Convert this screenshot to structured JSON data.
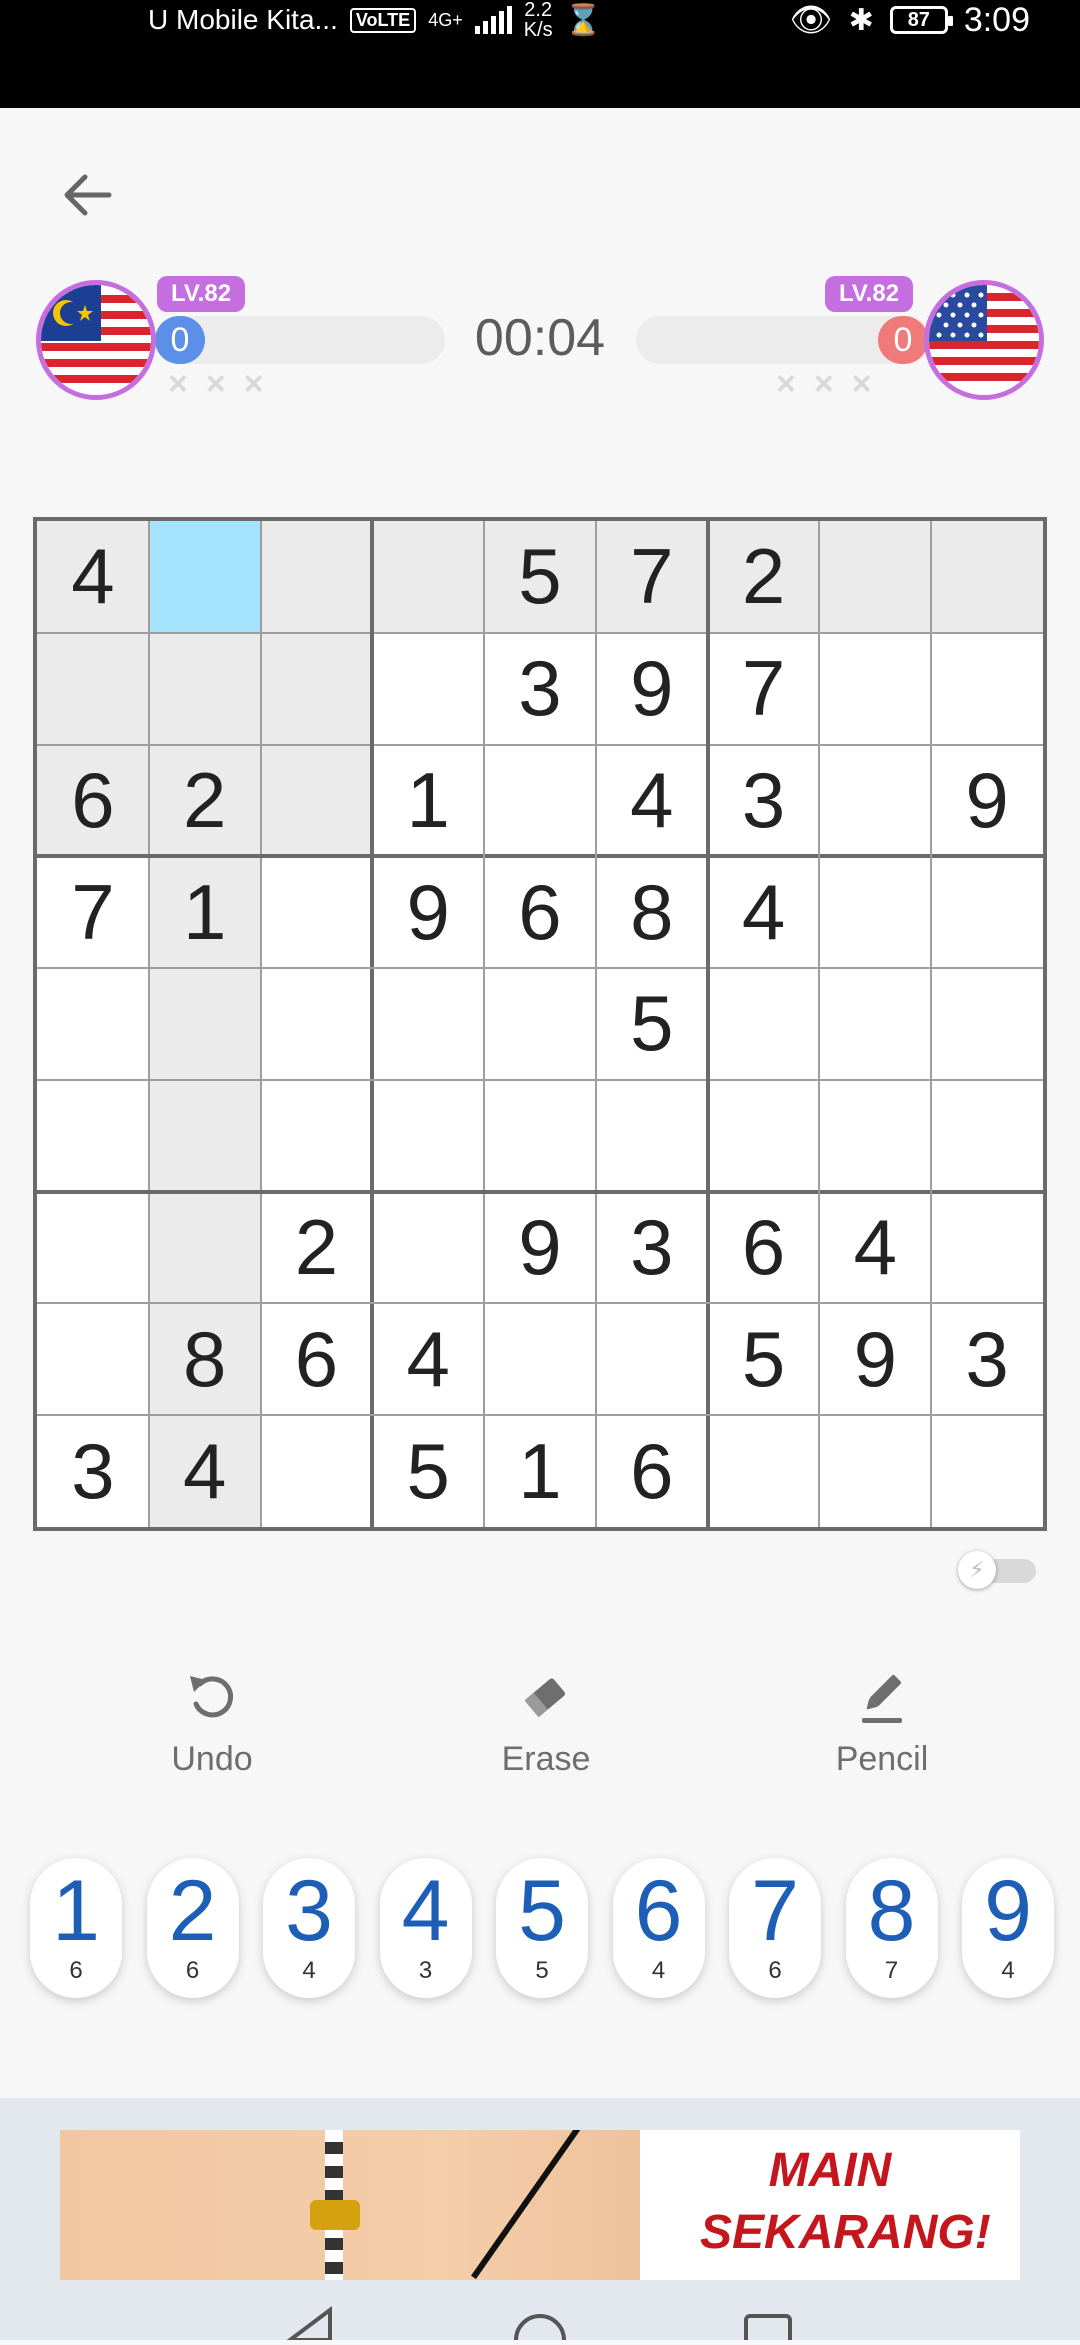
{
  "status_bar": {
    "carrier": "U Mobile Kita...",
    "volte": "VoLTE",
    "network": "4G+",
    "speed_value": "2.2",
    "speed_unit": "K/s",
    "battery": "87",
    "time": "3:09"
  },
  "players": {
    "left": {
      "level": "LV.82",
      "score": "0",
      "flag": "malaysia-flag-icon",
      "progress": 0
    },
    "right": {
      "level": "LV.82",
      "score": "0",
      "flag": "usa-flag-icon",
      "progress": 0
    }
  },
  "timer": "00:04",
  "mistake_marks": "×××",
  "board": {
    "cells": [
      [
        "4",
        "",
        "",
        "",
        "5",
        "7",
        "2",
        "",
        ""
      ],
      [
        "",
        "",
        "",
        "",
        "3",
        "9",
        "7",
        "",
        ""
      ],
      [
        "6",
        "2",
        "",
        "1",
        "",
        "4",
        "3",
        "",
        "9"
      ],
      [
        "7",
        "1",
        "",
        "9",
        "6",
        "8",
        "4",
        "",
        ""
      ],
      [
        "",
        "",
        "",
        "",
        "",
        "5",
        "",
        "",
        ""
      ],
      [
        "",
        "",
        "",
        "",
        "",
        "",
        "",
        "",
        ""
      ],
      [
        "",
        "",
        "2",
        "",
        "9",
        "3",
        "6",
        "4",
        ""
      ],
      [
        "",
        "8",
        "6",
        "4",
        "",
        "",
        "5",
        "9",
        "3"
      ],
      [
        "3",
        "4",
        "",
        "5",
        "1",
        "6",
        "",
        "",
        ""
      ]
    ],
    "selected": {
      "row": 0,
      "col": 1
    },
    "colors": {
      "selected": "#a6e3ff",
      "highlight": "#ebebeb"
    }
  },
  "tools": {
    "undo": "Undo",
    "erase": "Erase",
    "pencil": "Pencil"
  },
  "numpad": [
    {
      "n": "1",
      "c": "6"
    },
    {
      "n": "2",
      "c": "6"
    },
    {
      "n": "3",
      "c": "4"
    },
    {
      "n": "4",
      "c": "3"
    },
    {
      "n": "5",
      "c": "5"
    },
    {
      "n": "6",
      "c": "4"
    },
    {
      "n": "7",
      "c": "6"
    },
    {
      "n": "8",
      "c": "7"
    },
    {
      "n": "9",
      "c": "4"
    }
  ],
  "ad": {
    "line1": "MAIN",
    "line2": "SEKARANG!"
  },
  "accent_colors": {
    "level": "#c56ee0",
    "score_left": "#5b8fe8",
    "score_right": "#f07a7a",
    "digits": "#1d5fb6"
  }
}
